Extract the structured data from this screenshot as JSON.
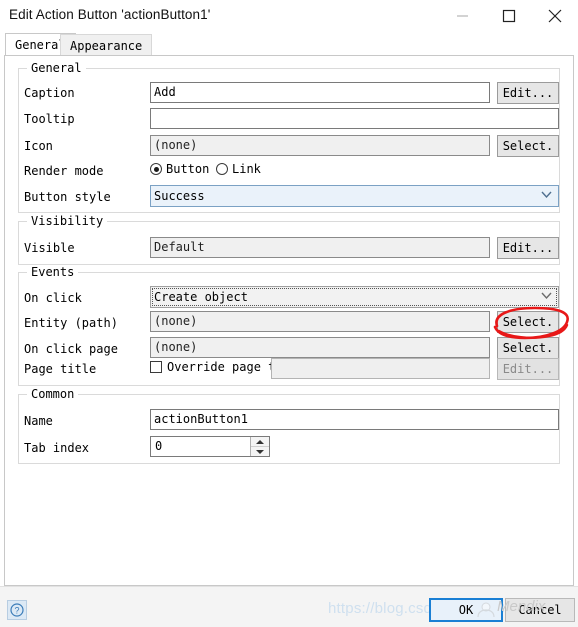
{
  "window": {
    "title": "Edit Action Button 'actionButton1'",
    "controls": {
      "minimize": "minimize-icon",
      "maximize": "maximize-icon",
      "close": "close-icon"
    }
  },
  "tabs": [
    {
      "label": "General",
      "active": true
    },
    {
      "label": "Appearance",
      "active": false
    }
  ],
  "groups": {
    "general": {
      "title": "General",
      "caption": {
        "label": "Caption",
        "value": "Add",
        "button": "Edit..."
      },
      "tooltip": {
        "label": "Tooltip",
        "value": "",
        "button": ""
      },
      "icon": {
        "label": "Icon",
        "value": "(none)",
        "button": "Select."
      },
      "render_mode": {
        "label": "Render mode",
        "options": [
          "Button",
          "Link"
        ],
        "selected": "Button"
      },
      "button_style": {
        "label": "Button style",
        "value": "Success"
      }
    },
    "visibility": {
      "title": "Visibility",
      "visible": {
        "label": "Visible",
        "value": "Default",
        "button": "Edit..."
      }
    },
    "events": {
      "title": "Events",
      "on_click": {
        "label": "On click",
        "value": "Create object"
      },
      "entity_path": {
        "label": "Entity (path)",
        "value": "(none)",
        "button": "Select."
      },
      "on_click_page": {
        "label": "On click page",
        "value": "(none)",
        "button": "Select."
      },
      "page_title": {
        "label": "Page title",
        "checkbox_label": "Override page t",
        "checked": false,
        "value": "",
        "button": "Edit..."
      }
    },
    "common": {
      "title": "Common",
      "name": {
        "label": "Name",
        "value": "actionButton1"
      },
      "tab_index": {
        "label": "Tab index",
        "value": "0"
      }
    }
  },
  "footer": {
    "help": "help-icon",
    "ok": "OK",
    "cancel": "Cancel"
  },
  "watermark": {
    "url": "https://blog.csdn.net/qq_39480....",
    "brand": "Mendix"
  },
  "colors": {
    "accent": "#1a7fd4",
    "combo_bg": "#eaf2fa",
    "annotation": "#e81818"
  }
}
